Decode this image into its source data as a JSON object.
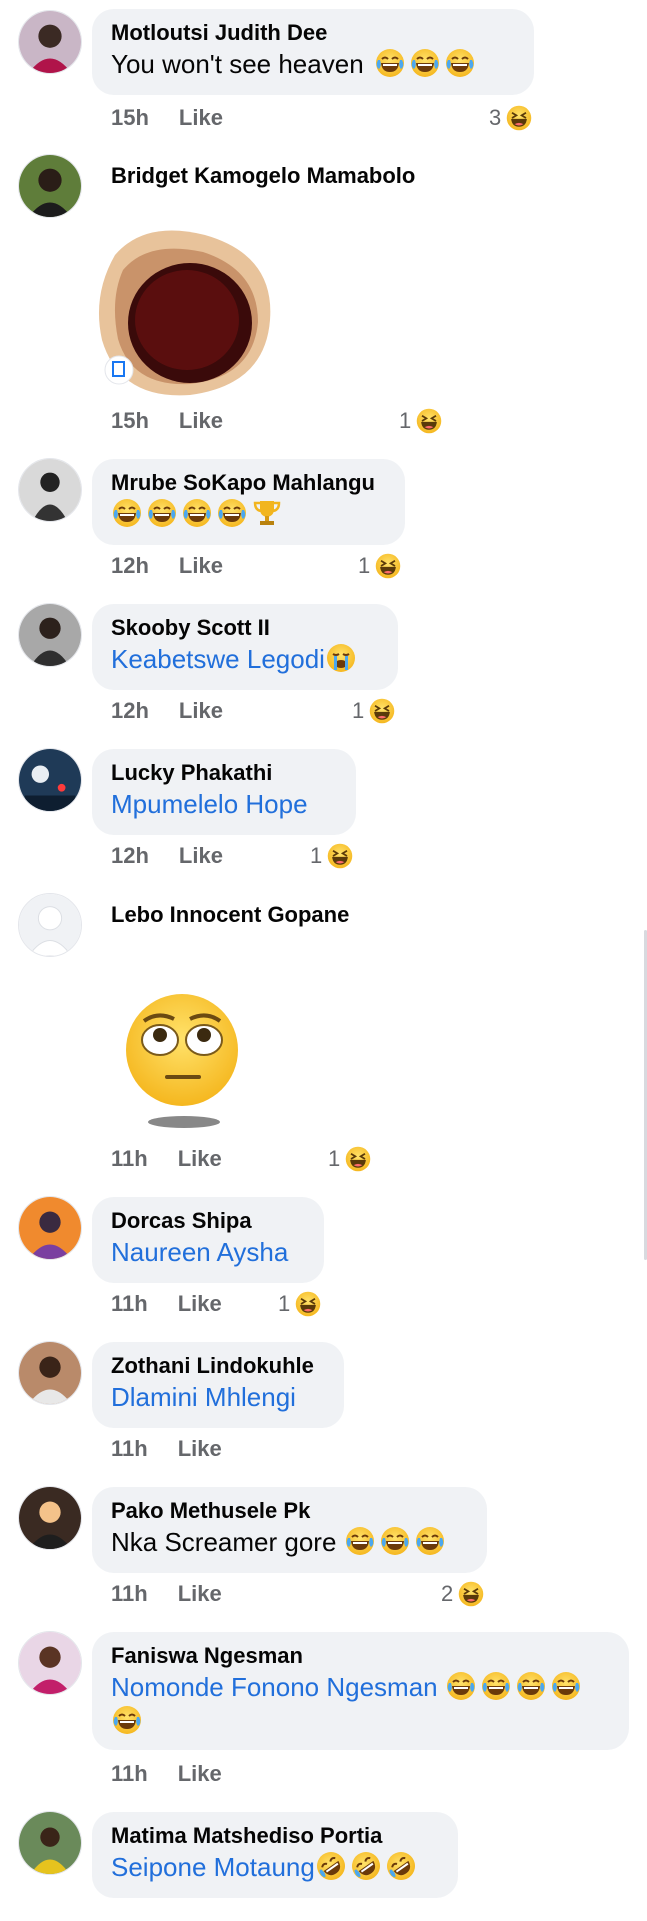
{
  "comments": [
    {
      "author": "Motloutsi Judith Dee",
      "text": "You won't see heaven",
      "time": "15h",
      "like": "Like",
      "reactions": "3"
    },
    {
      "author": "Bridget Kamogelo Mamabolo",
      "time": "15h",
      "like": "Like",
      "reactions": "1"
    },
    {
      "author": "Mrube SoKapo Mahlangu",
      "time": "12h",
      "like": "Like",
      "reactions": "1"
    },
    {
      "author": "Skooby Scott II",
      "text": "Keabetswe Legodi",
      "time": "12h",
      "like": "Like",
      "reactions": "1"
    },
    {
      "author": "Lucky Phakathi",
      "text": "Mpumelelo Hope",
      "time": "12h",
      "like": "Like",
      "reactions": "1"
    },
    {
      "author": "Lebo Innocent Gopane",
      "time": "11h",
      "like": "Like",
      "reactions": "1"
    },
    {
      "author": "Dorcas Shipa",
      "text": "Naureen Aysha",
      "time": "11h",
      "like": "Like",
      "reactions": "1"
    },
    {
      "author": "Zothani Lindokuhle",
      "text": "Dlamini Mhlengi",
      "time": "11h",
      "like": "Like"
    },
    {
      "author": "Pako Methusele Pk",
      "text": "Nka Screamer gore",
      "time": "11h",
      "like": "Like",
      "reactions": "2"
    },
    {
      "author": "Faniswa Ngesman",
      "text": "Nomonde Fonono Ngesman",
      "time": "11h",
      "like": "Like"
    },
    {
      "author": "Matima Matshediso Portia",
      "text": "Seipone Motaung"
    }
  ],
  "icons": {
    "laugh_tears": "face-with-tears-of-joy-icon",
    "haha_reaction": "haha-reaction-icon",
    "trophy": "trophy-icon",
    "crying": "loudly-crying-face-icon",
    "rofl": "rolling-on-floor-laughing-icon"
  },
  "colors": {
    "bubble": "#f0f2f5",
    "link": "#216fdb",
    "meta": "#65676b",
    "name": "#050505"
  }
}
